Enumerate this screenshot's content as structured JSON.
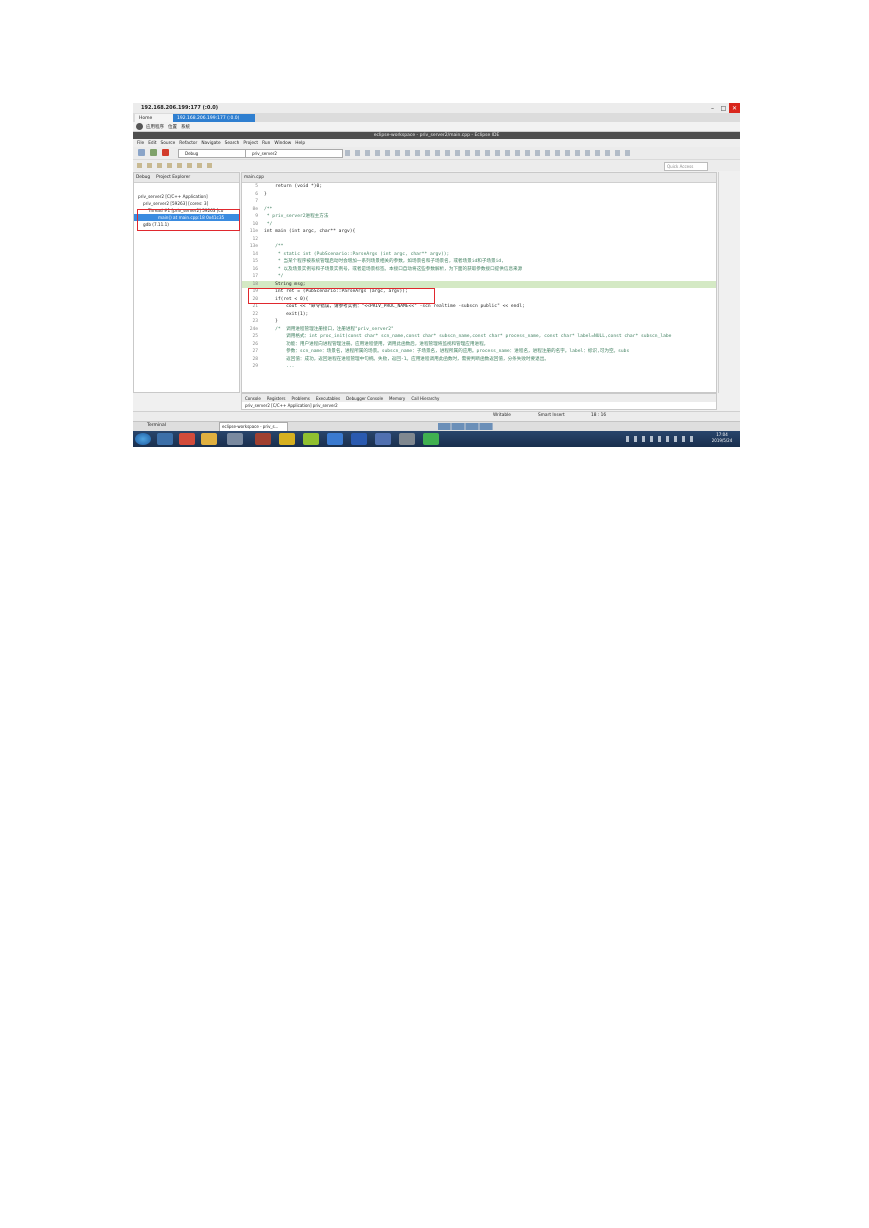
{
  "window": {
    "title": "192.168.206.199:177 (:0.0)",
    "controls": [
      "–",
      "□",
      "✕"
    ]
  },
  "tabs": [
    {
      "label": "Home"
    },
    {
      "label": "192.168.206.199:177 (:0.0)"
    }
  ],
  "gnome_menu": [
    "应用程序",
    "位置",
    "系统"
  ],
  "eclipse": {
    "title": "eclipse-workspace - priv_server2/main.cpp - Eclipse IDE",
    "menu": [
      "File",
      "Edit",
      "Source",
      "Refactor",
      "Navigate",
      "Search",
      "Project",
      "Run",
      "Window",
      "Help"
    ],
    "launch_mode": "Debug",
    "launch_config": "priv_server2",
    "quick_access_placeholder": "Quick Access"
  },
  "debug_view": {
    "tabs": [
      "Debug",
      "Project Explorer"
    ],
    "tree": [
      "priv_server2 [C/C++ Application]",
      "priv_server2 [59263] [cores: 3]",
      "Thread #1 [priv_server2] 59263 [co",
      "main() at main.cpp:18 0x41c35",
      "gdb (7.11.1)"
    ]
  },
  "editor": {
    "tab": "main.cpp",
    "lines": [
      {
        "n": "5",
        "t": "    return (void *)0;",
        "c": "code"
      },
      {
        "n": "6",
        "t": "}",
        "c": "code"
      },
      {
        "n": "7",
        "t": "",
        "c": "code"
      },
      {
        "n": "8⊖",
        "t": "/**",
        "c": "comment"
      },
      {
        "n": "9",
        "t": " * priv_server2进程主方法",
        "c": "comment"
      },
      {
        "n": "10",
        "t": " */",
        "c": "comment"
      },
      {
        "n": "11⊖",
        "t": "int main (int argc, char** argv){",
        "c": "code"
      },
      {
        "n": "12",
        "t": "",
        "c": "code"
      },
      {
        "n": "13⊖",
        "t": "    /**",
        "c": "comment"
      },
      {
        "n": "14",
        "t": "     * static int (PubScenario::ParseArgs (int argc, char** argv));",
        "c": "comment"
      },
      {
        "n": "15",
        "t": "     * 当某个程序被系统管理启动时会增加一系列场景相关的参数，如场景名和子场景名，或者场景id和子场景id,",
        "c": "comment"
      },
      {
        "n": "16",
        "t": "     * 以及场景实例号和子场景实例号，或者是场景标签。本接口自动将这些参数解析，为下面的获取参数接口提供信息来源",
        "c": "comment"
      },
      {
        "n": "17",
        "t": "     */",
        "c": "comment"
      },
      {
        "n": "18",
        "t": "    String msg;",
        "c": "code"
      },
      {
        "n": "19",
        "t": "    int ret = (PubScenario::ParseArgs (argc, argv));",
        "c": "code"
      },
      {
        "n": "20",
        "t": "    if(ret < 0){",
        "c": "code"
      },
      {
        "n": "21",
        "t": "        cout << \"命令错误，请参考实例：\"<<PRIV_PROC_NAME<<\" -scn realtime -subscn public\" << endl;",
        "c": "code"
      },
      {
        "n": "22",
        "t": "        exit(1);",
        "c": "code"
      },
      {
        "n": "23",
        "t": "    }",
        "c": "code"
      },
      {
        "n": "24⊖",
        "t": "    /*  调用进程管理注册接口，注册进程\"priv_server2\"",
        "c": "comment"
      },
      {
        "n": "25",
        "t": "        调用格式：int proc_init(const char* scn_name,const char* subscn_name,const char* process_name, const char* label=NULL,const char* subscn_labe",
        "c": "comment"
      },
      {
        "n": "26",
        "t": "        功能：用户进程向进程管理注册。应用进程使用，调用此函数后，进程管理将监视和管理应用进程。",
        "c": "comment"
      },
      {
        "n": "27",
        "t": "        参数：scn_name：场景名，进程所属的场景。subscn_name：子场景名，进程所属的应用。process_name：进程名，进程注册的名字。label：标识,可为空。subs",
        "c": "comment"
      },
      {
        "n": "28",
        "t": "        返回值：成功，返回进程在进程管理中句柄。失败，返回-1。应用进程调用此函数时，需要判断函数返回值，分条失败时要退出。",
        "c": "comment"
      },
      {
        "n": "29",
        "t": "        ...",
        "c": "comment"
      }
    ]
  },
  "console_view": {
    "tabs": [
      "Console",
      "Registers",
      "Problems",
      "Executables",
      "Debugger Console",
      "Memory",
      "Call Hierarchy"
    ],
    "text": "priv_server2 [C/C++ Application] priv_server2"
  },
  "status": {
    "writable": "Writable",
    "insert_mode": "Smart Insert",
    "position": "18 : 16"
  },
  "gnome_taskbar": [
    {
      "label": "Terminal"
    },
    {
      "label": "eclipse-workspace - priv_s..."
    }
  ],
  "clock": {
    "time": "17:04",
    "date": "2019/5/24"
  },
  "colors": {
    "highlight_box": "#e0282e",
    "accent": "#2f7fd0"
  }
}
